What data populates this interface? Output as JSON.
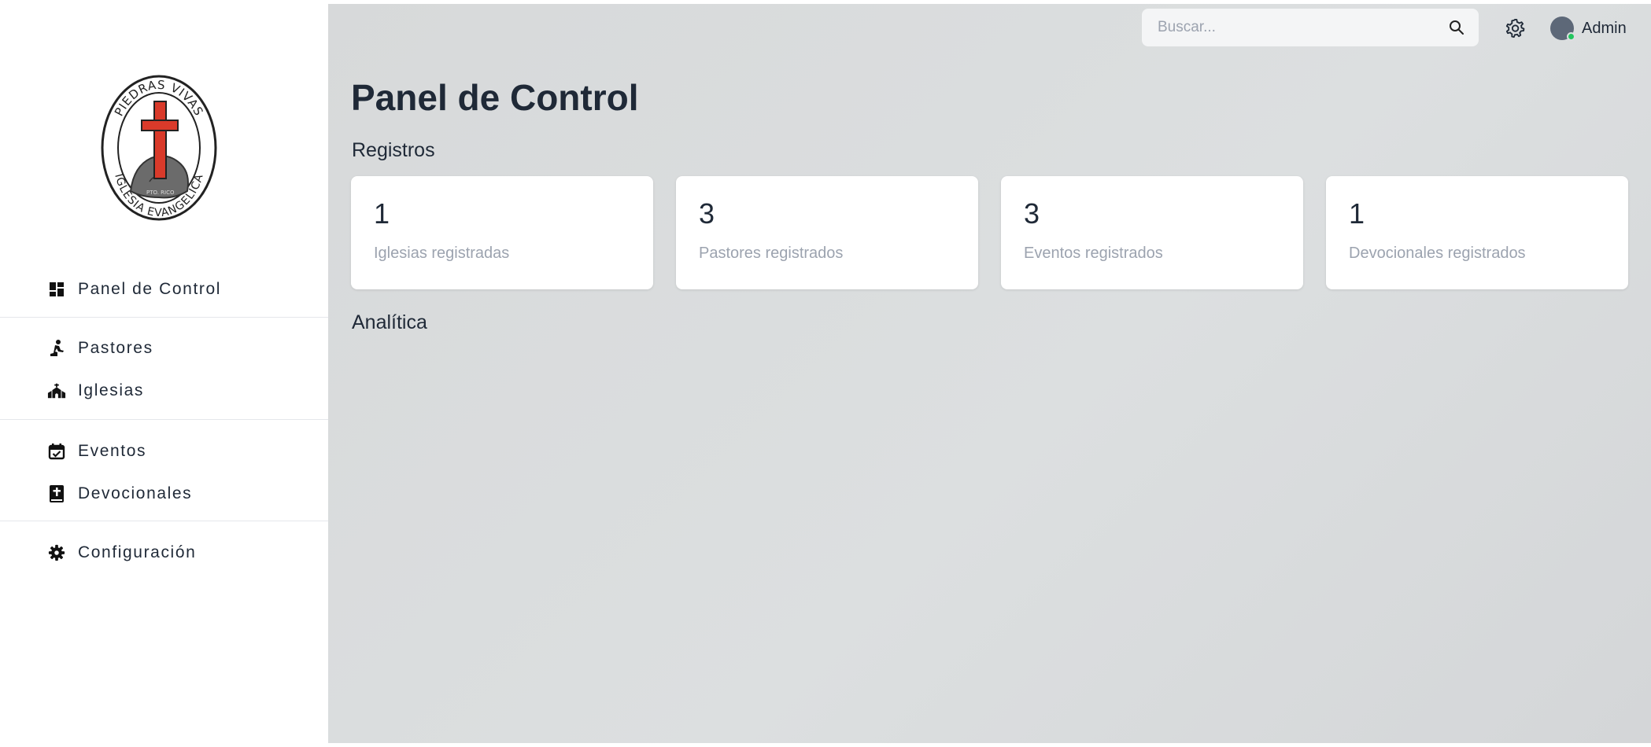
{
  "sidebar": {
    "logo": {
      "top_text": "PIEDRAS VIVAS",
      "bottom_text": "IGLESIA EVANGELICA",
      "stamp_text": "PTO. RICO"
    },
    "items": [
      {
        "label": "Panel de Control",
        "icon": "dashboard-icon"
      },
      {
        "label": "Pastores",
        "icon": "praying-person-icon"
      },
      {
        "label": "Iglesias",
        "icon": "church-icon"
      },
      {
        "label": "Eventos",
        "icon": "calendar-check-icon"
      },
      {
        "label": "Devocionales",
        "icon": "bible-icon"
      },
      {
        "label": "Configuración",
        "icon": "gear-icon"
      }
    ]
  },
  "header": {
    "search": {
      "placeholder": "Buscar...",
      "value": ""
    },
    "settings_icon": "gear-icon",
    "user": {
      "name": "Admin",
      "status_color": "#22c55e"
    }
  },
  "main": {
    "title": "Panel de Control",
    "sections": {
      "registros": "Registros",
      "analitica": "Analítica"
    },
    "stats": [
      {
        "value": "1",
        "label": "Iglesias registradas"
      },
      {
        "value": "3",
        "label": "Pastores registrados"
      },
      {
        "value": "3",
        "label": "Eventos registrados"
      },
      {
        "value": "1",
        "label": "Devocionales registrados"
      }
    ]
  },
  "colors": {
    "logo_cross": "#d93a2a",
    "logo_rock": "#6b6b6b",
    "text_primary": "#1f2937",
    "text_muted": "#9ca3af"
  }
}
